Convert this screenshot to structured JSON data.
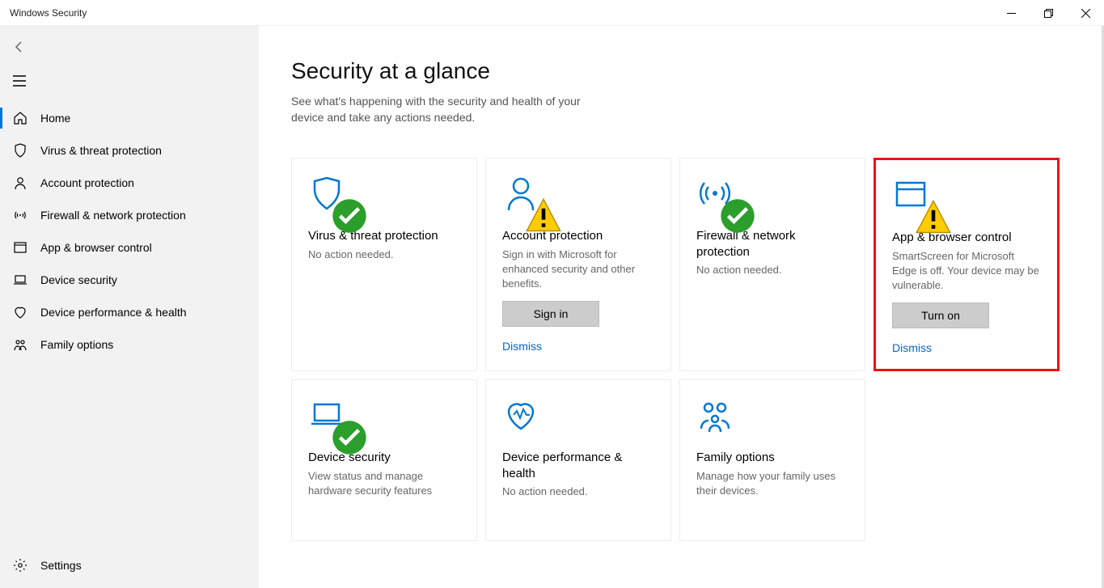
{
  "window": {
    "title": "Windows Security"
  },
  "sidebar": {
    "items": [
      {
        "label": "Home"
      },
      {
        "label": "Virus & threat protection"
      },
      {
        "label": "Account protection"
      },
      {
        "label": "Firewall & network protection"
      },
      {
        "label": "App & browser control"
      },
      {
        "label": "Device security"
      },
      {
        "label": "Device performance & health"
      },
      {
        "label": "Family options"
      }
    ],
    "settings_label": "Settings"
  },
  "page": {
    "heading": "Security at a glance",
    "subtitle": "See what's happening with the security and health of your device and take any actions needed."
  },
  "cards": {
    "virus": {
      "title": "Virus & threat protection",
      "desc": "No action needed."
    },
    "account": {
      "title": "Account protection",
      "desc": "Sign in with Microsoft for enhanced security and other benefits.",
      "button": "Sign in",
      "dismiss": "Dismiss"
    },
    "firewall": {
      "title": "Firewall & network protection",
      "desc": "No action needed."
    },
    "appbrowser": {
      "title": "App & browser control",
      "desc": "SmartScreen for Microsoft Edge is off. Your device may be vulnerable.",
      "button": "Turn on",
      "dismiss": "Dismiss"
    },
    "devicesecurity": {
      "title": "Device security",
      "desc": "View status and manage hardware security features"
    },
    "performance": {
      "title": "Device performance & health",
      "desc": "No action needed."
    },
    "family": {
      "title": "Family options",
      "desc": "Manage how your family uses their devices."
    }
  }
}
